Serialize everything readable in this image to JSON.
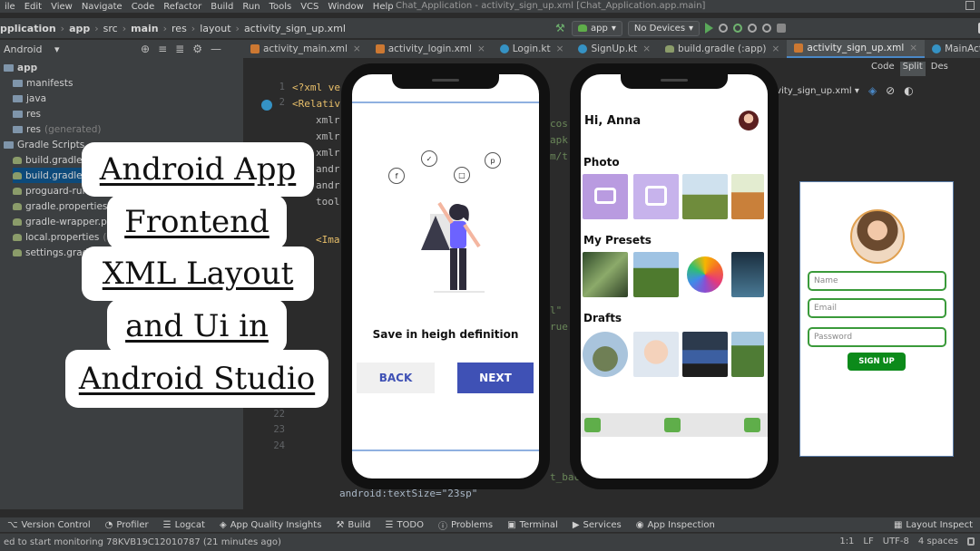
{
  "menubar": {
    "items": [
      "ile",
      "Edit",
      "View",
      "Navigate",
      "Code",
      "Refactor",
      "Build",
      "Run",
      "Tools",
      "VCS",
      "Window",
      "Help"
    ],
    "window_title": "Chat_Application - activity_sign_up.xml [Chat_Application.app.main]"
  },
  "breadcrumb": {
    "items": [
      "pplication",
      "app",
      "src",
      "main",
      "res",
      "layout",
      "activity_sign_up.xml"
    ]
  },
  "run_config": {
    "module": "app",
    "device": "No Devices"
  },
  "project_panel": {
    "view": "Android"
  },
  "tabs": [
    {
      "label": "activity_main.xml",
      "icon": "xml-icon"
    },
    {
      "label": "activity_login.xml",
      "icon": "xml-icon"
    },
    {
      "label": "Login.kt",
      "icon": "kotlin-icon"
    },
    {
      "label": "SignUp.kt",
      "icon": "kotlin-icon"
    },
    {
      "label": "build.gradle (:app)",
      "icon": "gradle-icon"
    },
    {
      "label": "activity_sign_up.xml",
      "icon": "xml-icon",
      "active": true
    },
    {
      "label": "MainActivity.kt",
      "icon": "kotlin-icon"
    }
  ],
  "tree": [
    {
      "label": "app",
      "bold": true
    },
    {
      "label": "manifests"
    },
    {
      "label": "java"
    },
    {
      "label": "res"
    },
    {
      "label": "res",
      "suffix": "(generated)"
    },
    {
      "label": "Gradle Scripts"
    },
    {
      "label": "build.gradle",
      "suffix": "(P"
    },
    {
      "label": "build.gradle",
      "suffix": "("
    },
    {
      "label": "proguard-rule"
    },
    {
      "label": "gradle.properties",
      "suffix": "(P"
    },
    {
      "label": "gradle-wrapper.prope"
    },
    {
      "label": "local.properties",
      "suffix": "(SDK"
    },
    {
      "label": "settings.gradle"
    }
  ],
  "editor": {
    "line_numbers": [
      "1",
      "2",
      "",
      "",
      "",
      "",
      "",
      "",
      "",
      "",
      "",
      "",
      "",
      "",
      "",
      "",
      "",
      "",
      "",
      "",
      "21",
      "22",
      "23",
      "24"
    ],
    "lines": [
      {
        "parts": [
          [
            "tag",
            "<?xml ve"
          ]
        ]
      },
      {
        "parts": [
          [
            "tag",
            "<Relativ"
          ]
        ]
      },
      {
        "parts": [
          [
            "attr",
            "xmlr"
          ]
        ]
      },
      {
        "parts": [
          [
            "attr",
            "xmlr"
          ]
        ]
      },
      {
        "parts": [
          [
            "attr",
            "xmlr"
          ]
        ]
      },
      {
        "parts": [
          [
            "attr",
            "andr"
          ]
        ]
      },
      {
        "parts": [
          [
            "attr",
            "andr"
          ]
        ]
      },
      {
        "parts": [
          [
            "attr",
            "tool"
          ]
        ]
      },
      {
        "parts": [
          [
            "tag",
            "<Ima"
          ]
        ]
      }
    ],
    "right_fragments": [
      "cos",
      "apk",
      "m/t",
      "l\"",
      "rue"
    ],
    "bottom_lines": [
      "android:textSize=\"23sp\"",
      "t_bac"
    ]
  },
  "view_switch": {
    "code": "Code",
    "split": "Split",
    "design": "Des"
  },
  "design_toolbar": {
    "file": "ctivity_sign_up.xml"
  },
  "preview": {
    "fields": [
      "Name",
      "Email",
      "Password"
    ],
    "signup_label": "SIGN UP"
  },
  "title_card": {
    "lines": [
      "Android App",
      "Frontend",
      "XML Layout",
      "and Ui in",
      "Android Studio"
    ]
  },
  "phone_left": {
    "caption": "Save in heigh definition",
    "back_label": "BACK",
    "next_label": "NEXT"
  },
  "phone_right": {
    "greeting": "Hi, Anna",
    "section_photo": "Photo",
    "section_presets": "My Presets",
    "section_drafts": "Drafts"
  },
  "toolstrip": [
    {
      "label": "Version Control",
      "icon": "branch-icon"
    },
    {
      "label": "Profiler",
      "icon": "gauge-icon"
    },
    {
      "label": "Logcat",
      "icon": "list-icon"
    },
    {
      "label": "App Quality Insights",
      "icon": "shield-icon"
    },
    {
      "label": "Build",
      "icon": "hammer-icon"
    },
    {
      "label": "TODO",
      "icon": "list-icon"
    },
    {
      "label": "Problems",
      "icon": "info-icon"
    },
    {
      "label": "Terminal",
      "icon": "terminal-icon"
    },
    {
      "label": "Services",
      "icon": "play-icon"
    },
    {
      "label": "App Inspection",
      "icon": "inspect-icon"
    },
    {
      "label": "Layout Inspect",
      "icon": "layout-icon"
    }
  ],
  "status": {
    "message": "ed to start monitoring 78KVB19C12010787 (21 minutes ago)",
    "position": "1:1",
    "line_sep": "LF",
    "encoding": "UTF-8",
    "indent": "4 spaces"
  },
  "colors": {
    "accent": "#3f51b5",
    "ide_bg": "#2b2b2b",
    "panel_bg": "#3c3f41",
    "signup_green": "#0c8a1a"
  }
}
